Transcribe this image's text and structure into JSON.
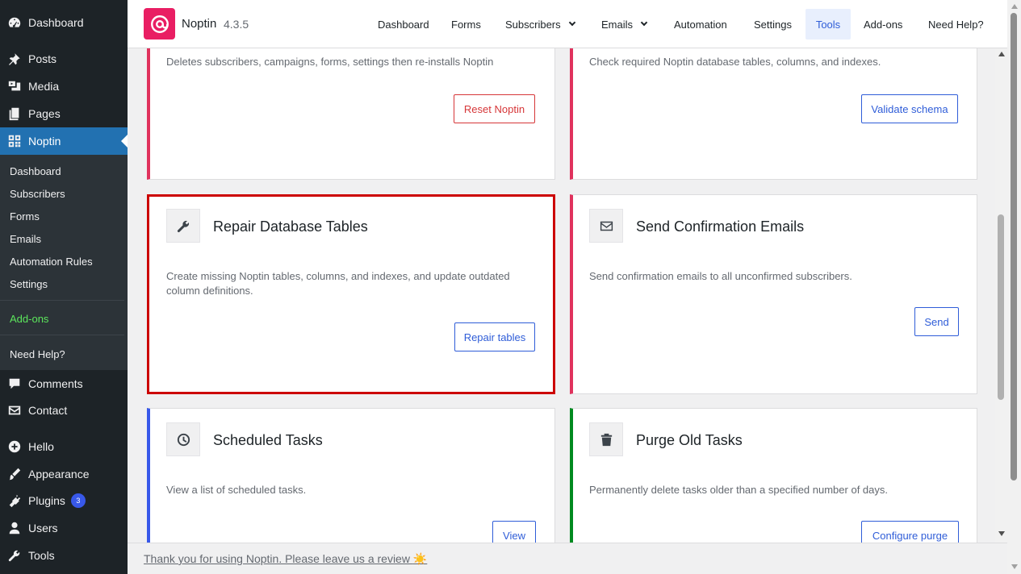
{
  "sidebar": {
    "top_items": [
      {
        "label": "Dashboard",
        "icon": "dashboard-icon"
      },
      {
        "label": "Posts",
        "icon": "pin-icon"
      },
      {
        "label": "Media",
        "icon": "media-icon"
      },
      {
        "label": "Pages",
        "icon": "pages-icon"
      },
      {
        "label": "Noptin",
        "icon": "noptin-grid-icon",
        "current": true
      }
    ],
    "submenu": [
      "Dashboard",
      "Subscribers",
      "Forms",
      "Emails",
      "Automation Rules",
      "Settings",
      "Add-ons",
      "Need Help?"
    ],
    "bottom_items": [
      {
        "label": "Comments",
        "icon": "comment-icon"
      },
      {
        "label": "Contact",
        "icon": "mail-icon"
      },
      {
        "label": "Hello",
        "icon": "plus-circle-icon"
      },
      {
        "label": "Appearance",
        "icon": "brush-icon"
      },
      {
        "label": "Plugins",
        "icon": "plugin-icon",
        "badge": "3"
      },
      {
        "label": "Users",
        "icon": "user-icon"
      },
      {
        "label": "Tools",
        "icon": "wrench-icon"
      }
    ]
  },
  "header": {
    "brand": "Noptin",
    "version": "4.3.5",
    "nav": [
      "Dashboard",
      "Forms",
      "Subscribers",
      "Emails",
      "Automation",
      "Settings",
      "Tools",
      "Add-ons",
      "Need Help?"
    ],
    "active_nav": "Tools"
  },
  "cards": {
    "reset": {
      "desc": "Deletes subscribers, campaigns, forms, settings then re-installs Noptin",
      "button": "Reset Noptin"
    },
    "validate": {
      "desc": "Check required Noptin database tables, columns, and indexes.",
      "button": "Validate schema"
    },
    "repair": {
      "title": "Repair Database Tables",
      "desc": "Create missing Noptin tables, columns, and indexes, and update outdated column definitions.",
      "button": "Repair tables",
      "icon": "wrench-icon"
    },
    "confirm": {
      "title": "Send Confirmation Emails",
      "desc": "Send confirmation emails to all unconfirmed subscribers.",
      "button": "Send",
      "icon": "envelope-icon"
    },
    "scheduled": {
      "title": "Scheduled Tasks",
      "desc": "View a list of scheduled tasks.",
      "button": "View",
      "icon": "clock-icon"
    },
    "purge": {
      "title": "Purge Old Tasks",
      "desc": "Permanently delete tasks older than a specified number of days.",
      "button": "Configure purge",
      "icon": "trash-icon"
    }
  },
  "footer": {
    "text": "Thank you for using Noptin. Please leave us a review",
    "emoji": "☀️"
  },
  "colors": {
    "accent_pink": "#e0325d",
    "accent_blue": "#3858e9",
    "accent_green": "#008a20",
    "selection_red": "#cc0000",
    "wp_blue": "#2271b1",
    "logo_pink": "#e91e63"
  }
}
